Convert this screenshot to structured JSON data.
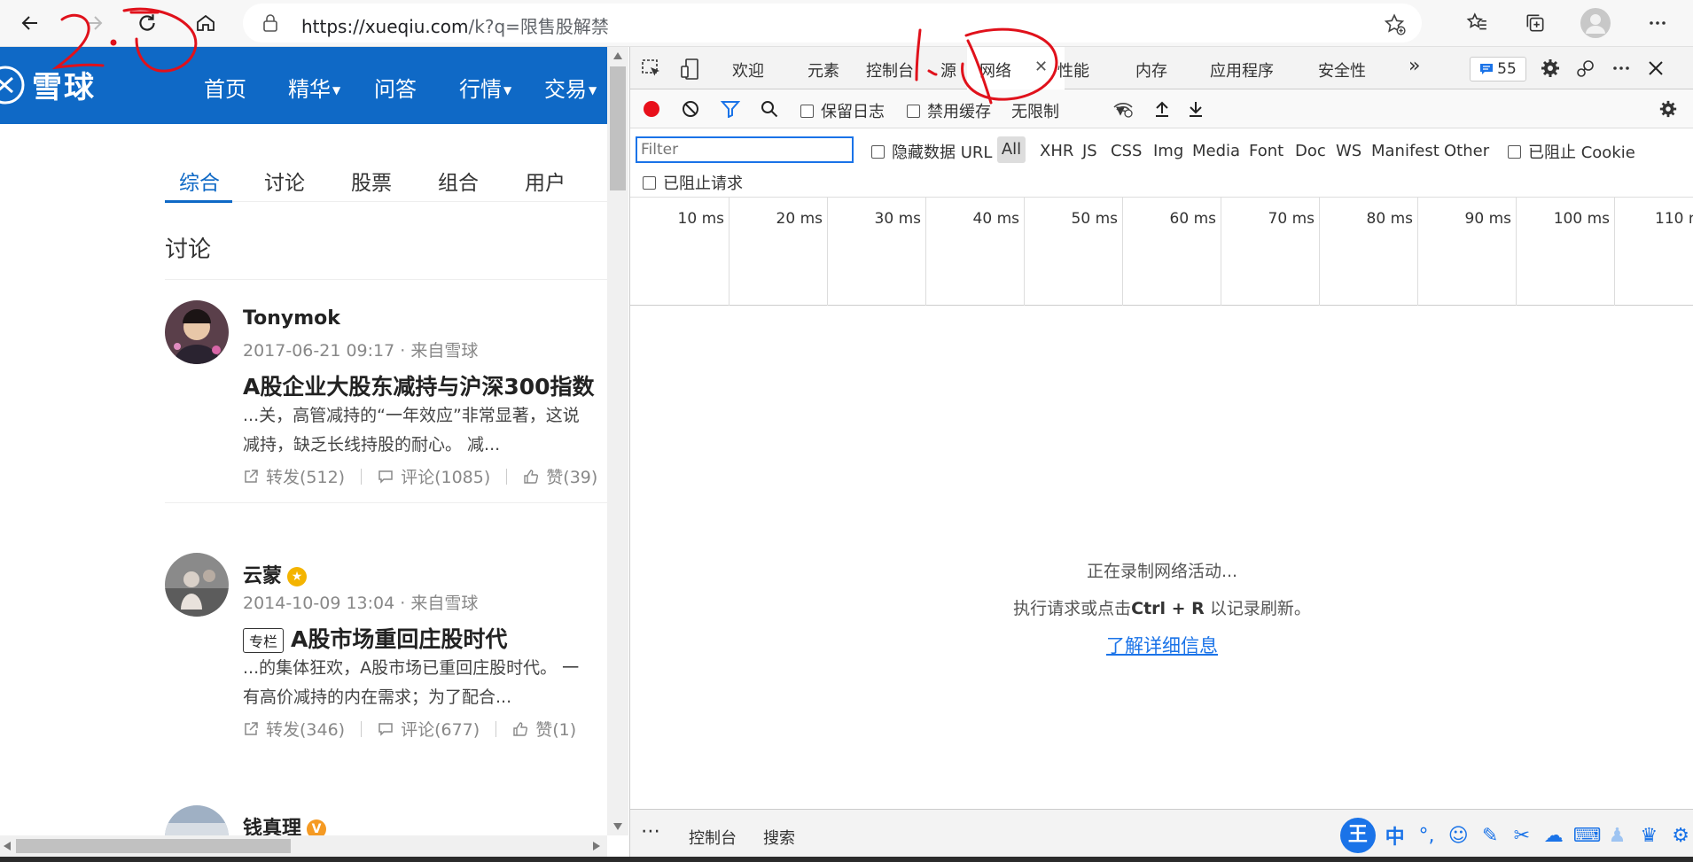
{
  "browser": {
    "url_prefix": "https://xueqiu.com",
    "url_path": "/k?q=限售股解禁"
  },
  "site": {
    "logo_text": "雪球",
    "nav": [
      "首页",
      "精华",
      "问答",
      "行情",
      "交易"
    ],
    "tabs": [
      "综合",
      "讨论",
      "股票",
      "组合",
      "用户"
    ],
    "section_title": "讨论",
    "posts": [
      {
        "author": "Tonymok",
        "meta": "2017-06-21 09:17 · 来自雪球",
        "title": "A股企业大股东减持与沪深300指数",
        "excerpt_1": "...关，高管减持的“一年效应”非常显著，这说",
        "excerpt_2": "减持，缺乏长线持股的耐心。 减...",
        "repost": "转发(512)",
        "comment": "评论(1085)",
        "like": "赞(39)"
      },
      {
        "author": "云蒙",
        "meta": "2014-10-09 13:04 · 来自雪球",
        "tag": "专栏",
        "title": "A股市场重回庄股时代",
        "excerpt_1": "...的集体狂欢，A股市场已重回庄股时代。 一",
        "excerpt_2": "有高价减持的内在需求；为了配合...",
        "repost": "转发(346)",
        "comment": "评论(677)",
        "like": "赞(1)"
      },
      {
        "author": "钱真理"
      }
    ],
    "badge_v": "V"
  },
  "devtools": {
    "tabs": [
      "欢迎",
      "元素",
      "控制台",
      "源",
      "网络",
      "性能",
      "内存",
      "应用程序",
      "安全性"
    ],
    "more_tabs": "»",
    "message_count": "55",
    "toolbar": {
      "preserve_log": "保留日志",
      "disable_cache": "禁用缓存",
      "throttling": "无限制"
    },
    "filter": {
      "placeholder": "Filter",
      "hide_data_urls": "隐藏数据 URL",
      "types": [
        "All",
        "XHR",
        "JS",
        "CSS",
        "Img",
        "Media",
        "Font",
        "Doc",
        "WS",
        "Manifest",
        "Other"
      ],
      "blocked_cookies": "已阻止 Cookie",
      "blocked_requests": "已阻止请求"
    },
    "timeline_ticks": [
      "10 ms",
      "20 ms",
      "30 ms",
      "40 ms",
      "50 ms",
      "60 ms",
      "70 ms",
      "80 ms",
      "90 ms",
      "100 ms",
      "110 ms"
    ],
    "recording": {
      "line1": "正在录制网络活动...",
      "line2_prefix": "执行请求或点击",
      "line2_key": "Ctrl + R",
      "line2_suffix": " 以记录刷新。",
      "learn_more": "了解详细信息"
    },
    "drawer_tabs": [
      "控制台",
      "搜索"
    ],
    "drawer_more": "⋯"
  },
  "ime": {
    "badge": "王",
    "lang": "中"
  },
  "colors": {
    "site_blue": "#0f69c6",
    "record_red": "#e8101b",
    "link_blue": "#1a73e8",
    "annotation_red": "#e0111b"
  }
}
